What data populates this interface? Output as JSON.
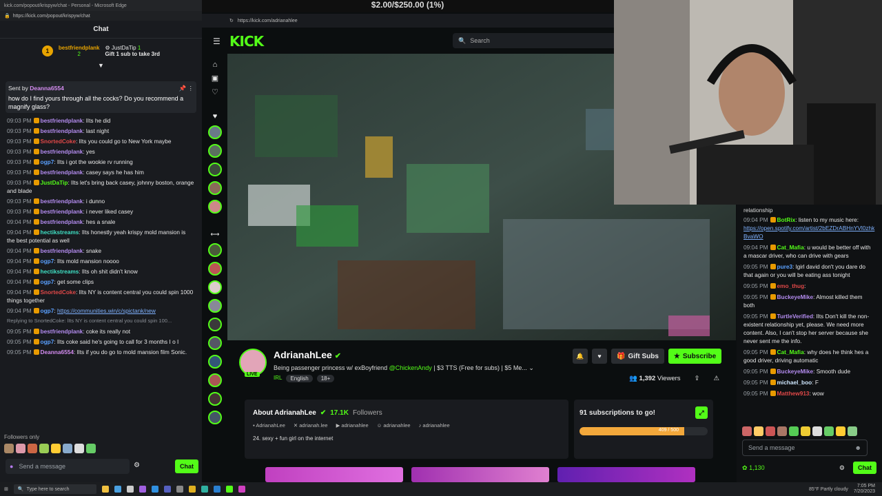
{
  "left": {
    "window_title": "kick.com/popout/krispyw/chat - Personal - Microsoft Edge",
    "url": "https://kick.com/popout/krispyw/chat",
    "chat_title": "Chat",
    "gift_leader": {
      "name": "bestfriendplank",
      "count": "2",
      "name2": "JustDaTip",
      "count2": "1",
      "cta": "Gift 1 sub to take 3rd"
    },
    "pinned": {
      "label": "Sent by",
      "user": "Deanna6554",
      "text": "how do I find yours through all the cocks? Do you recommend a magnify glass?"
    },
    "messages": [
      {
        "time": "09:03 PM",
        "user": "bestfriendplank",
        "color": "#b48cf0",
        "text": "lIts he did"
      },
      {
        "time": "09:03 PM",
        "user": "bestfriendplank",
        "color": "#b48cf0",
        "text": "last night"
      },
      {
        "time": "09:03 PM",
        "user": "SnortedCoke",
        "color": "#e04848",
        "text": "lIts you could go to New York maybe"
      },
      {
        "time": "09:03 PM",
        "user": "bestfriendplank",
        "color": "#b48cf0",
        "text": "yes"
      },
      {
        "time": "09:03 PM",
        "user": "ogp7",
        "color": "#5aa0ff",
        "text": "lIts i got the wookie rv running"
      },
      {
        "time": "09:03 PM",
        "user": "bestfriendplank",
        "color": "#b48cf0",
        "text": "casey says he has him"
      },
      {
        "time": "09:03 PM",
        "user": "JustDaTip",
        "color": "#53fc18",
        "text": "lIts let's bring back casey, johnny boston, orange and blade"
      },
      {
        "time": "09:03 PM",
        "user": "bestfriendplank",
        "color": "#b48cf0",
        "text": "i dunno"
      },
      {
        "time": "09:03 PM",
        "user": "bestfriendplank",
        "color": "#b48cf0",
        "text": "i never liked casey"
      },
      {
        "time": "09:04 PM",
        "user": "bestfriendplank",
        "color": "#b48cf0",
        "text": "hes a snale"
      },
      {
        "time": "09:04 PM",
        "user": "hectikstreams",
        "color": "#3fe0c4",
        "text": "lIts honestly yeah krispy mold mansion is the best potential as well"
      },
      {
        "time": "09:04 PM",
        "user": "bestfriendplank",
        "color": "#b48cf0",
        "text": "snake"
      },
      {
        "time": "09:04 PM",
        "user": "ogp7",
        "color": "#5aa0ff",
        "text": "lIts mold mansion noooo"
      },
      {
        "time": "09:04 PM",
        "user": "hectikstreams",
        "color": "#3fe0c4",
        "text": "lIts oh shit didn't know"
      },
      {
        "time": "09:04 PM",
        "user": "ogp7",
        "color": "#5aa0ff",
        "text": "get some clips"
      },
      {
        "time": "09:04 PM",
        "user": "SnortedCoke",
        "color": "#e04848",
        "text": "lIts NY is content central you could spin 1000 things together"
      },
      {
        "time": "09:04 PM",
        "user": "ogp7",
        "color": "#5aa0ff",
        "text": "https://communities.win/c/spictank/new"
      }
    ],
    "reply": {
      "text": "Replying to SnortedCoke: lIts NY is content central you could spin 100..."
    },
    "messages2": [
      {
        "time": "09:05 PM",
        "user": "bestfriendplank",
        "color": "#b48cf0",
        "text": "coke its really not"
      },
      {
        "time": "09:05 PM",
        "user": "ogp7",
        "color": "#5aa0ff",
        "text": "lIts coke said he's going to call for 3 months I o I"
      },
      {
        "time": "09:05 PM",
        "user": "Deanna6554",
        "color": "#d48cf0",
        "text": "lIts if you do go to mold mansion film Sonic."
      }
    ],
    "followers_only": "Followers only",
    "input_placeholder": "Send a message",
    "chat_button": "Chat"
  },
  "price": "$2.00/$250.00 (1%)",
  "kick": {
    "url": "https://kick.com/adrianahlee",
    "logo": "KICK",
    "search_placeholder": "Search",
    "streamer": {
      "name": "AdrianahLee",
      "live": "LIVE",
      "title_prefix": "Being passenger princess w/ exBoyfriend",
      "title_mention": "@ChickenAndy",
      "title_suffix": "| $3 TTS (Free for subs) | $5 Me...",
      "tag_irl": "IRL",
      "tag_lang": "English",
      "tag_age": "18+",
      "viewers": "1,392",
      "viewers_label": "Viewers"
    },
    "buttons": {
      "gift": "Gift Subs",
      "subscribe": "Subscribe"
    },
    "about": {
      "title": "About AdrianahLee",
      "followers": "17.1K",
      "followers_label": "Followers",
      "socials": [
        "AdrianahLee",
        "adrianah.lee",
        "adrianahlee",
        "adrianahlee",
        "adrianahlee"
      ],
      "bio": "24. sexy + fun girl on the internet"
    },
    "subgoal": {
      "title": "91 subscriptions to go!",
      "progress": "409 / 500",
      "fraction": 0.818
    }
  },
  "right": {
    "messages": [
      {
        "time": "09:04 PM",
        "user": "BotRix",
        "color": "#53fc18",
        "text": "listen to my music here:",
        "link": "https://open.spotify.com/artist/2bEZDrABHnYVl0zhkBvaWO"
      },
      {
        "time": "09:04 PM",
        "user": "Cat_Mafia",
        "color": "#53fc18",
        "text": "u would be better off with a mascar driver, who can drive with gears"
      },
      {
        "time": "09:05 PM",
        "user": "pure3",
        "color": "#5aa0ff",
        "text": "lgirl david don't you dare do that again or you will be eating ass tonight"
      },
      {
        "time": "09:05 PM",
        "user": "emo_thug",
        "color": "#e04848",
        "text": ""
      },
      {
        "time": "09:05 PM",
        "user": "BuckeyeMike",
        "color": "#b48cf0",
        "text": "Almost killed them both"
      },
      {
        "time": "09:05 PM",
        "user": "TurtleVerified",
        "color": "#b48cf0",
        "text": "lIts Don't kill the non-existent relationship yet, please. We need more content. Also, I can't stop her server because she never sent me the info."
      },
      {
        "time": "09:05 PM",
        "user": "Cat_Mafia",
        "color": "#53fc18",
        "text": "why does he think hes a good driver, driving automatic"
      },
      {
        "time": "09:05 PM",
        "user": "BuckeyeMike",
        "color": "#b48cf0",
        "text": "Smooth dude"
      },
      {
        "time": "09:05 PM",
        "user": "michael_boo",
        "color": "#cfe8ff",
        "text": "F"
      },
      {
        "time": "09:05 PM",
        "user": "Matthew913",
        "color": "#e04848",
        "text": "wow"
      }
    ],
    "top_fragment": "relationship",
    "input_placeholder": "Send a message",
    "points": "1,130",
    "chat_button": "Chat"
  },
  "taskbar": {
    "search": "Type here to search",
    "weather": "85°F  Partly cloudy",
    "time": "7:05 PM",
    "date": "7/20/2023"
  }
}
